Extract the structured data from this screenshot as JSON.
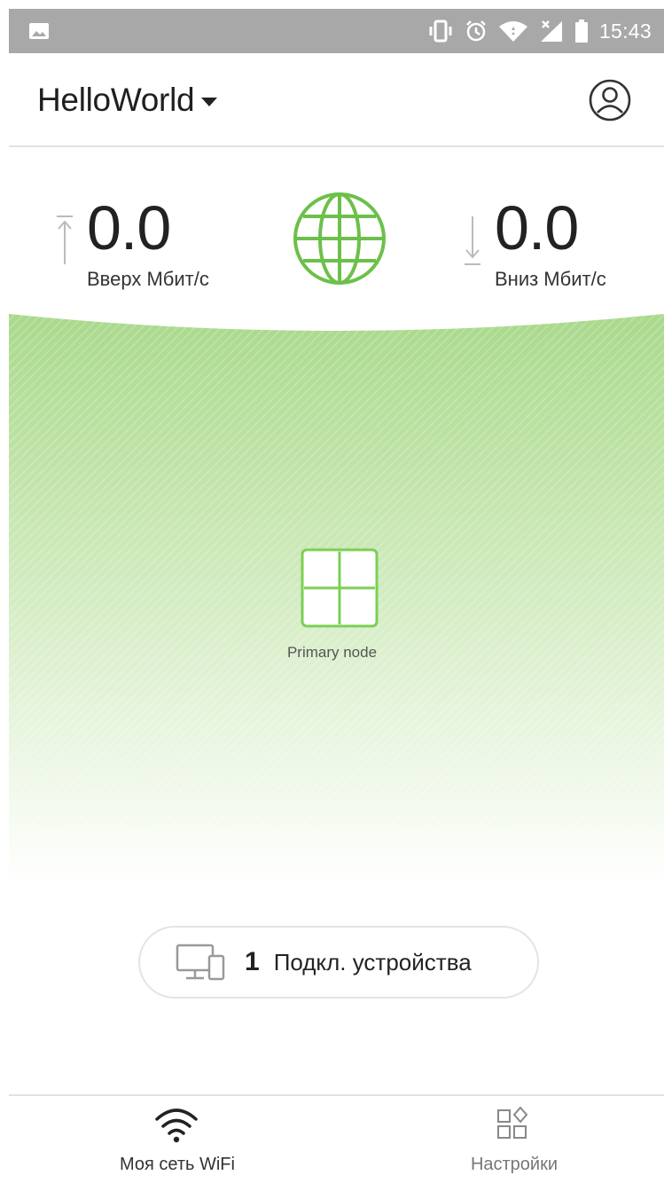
{
  "status_bar": {
    "time": "15:43",
    "icons": [
      "gallery-icon",
      "vibrate-icon",
      "alarm-icon",
      "wifi-icon",
      "signal-icon",
      "battery-icon"
    ]
  },
  "header": {
    "network_name": "HelloWorld",
    "icons": [
      "chevron-down-icon",
      "account-icon"
    ]
  },
  "speed": {
    "upload": {
      "value": "0.0",
      "label": "Вверх  Мбит/с"
    },
    "download": {
      "value": "0.0",
      "label": "Вниз  Мбит/с"
    }
  },
  "topology": {
    "node_label": "Primary node",
    "accent_color": "#6cc04a"
  },
  "devices": {
    "count": "1",
    "label": "Подкл. устройства"
  },
  "bottom_nav": {
    "items": [
      {
        "label": "Моя сеть WiFi",
        "icon": "wifi-icon",
        "active": true
      },
      {
        "label": "Настройки",
        "icon": "settings-grid-icon",
        "active": false
      }
    ]
  }
}
